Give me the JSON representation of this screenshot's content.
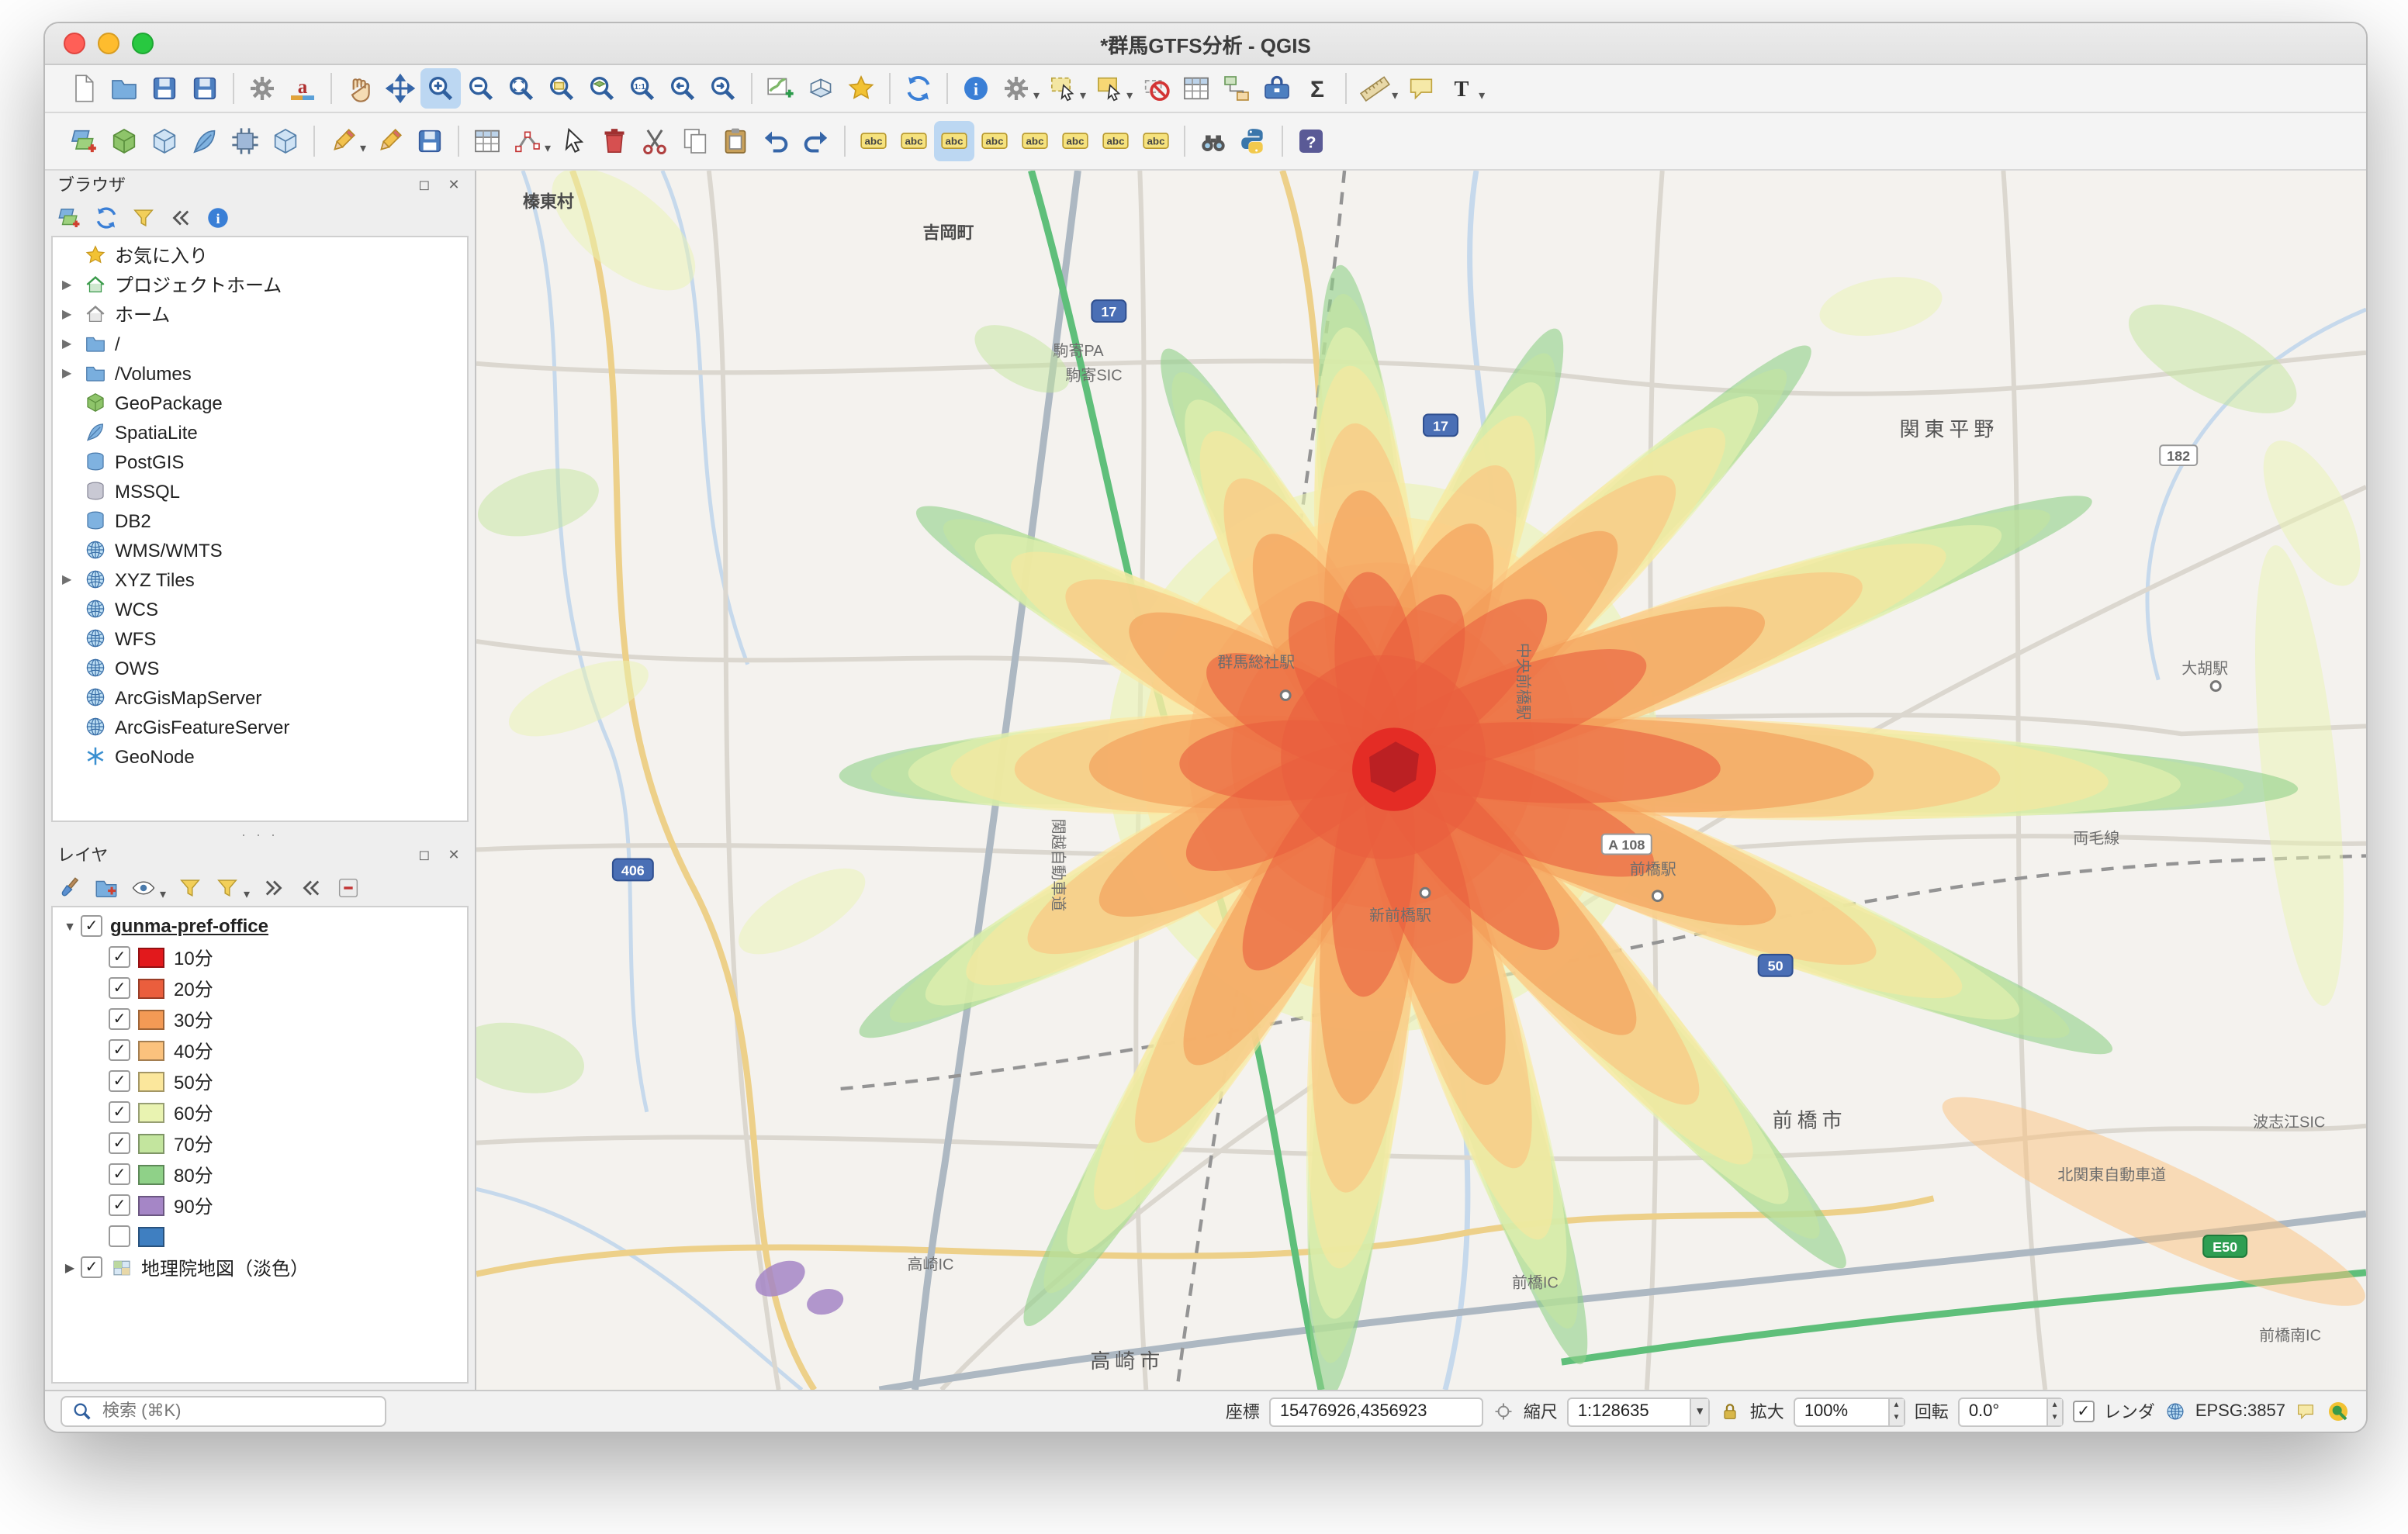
{
  "window": {
    "title": "*群馬GTFS分析 - QGIS"
  },
  "browser": {
    "title": "ブラウザ",
    "items": [
      {
        "label": "お気に入り",
        "icon": "star-icon"
      },
      {
        "label": "プロジェクトホーム",
        "icon": "project-home-icon"
      },
      {
        "label": "ホーム",
        "icon": "home-icon"
      },
      {
        "label": "/",
        "icon": "folder-icon"
      },
      {
        "label": "/Volumes",
        "icon": "folder-icon"
      },
      {
        "label": "GeoPackage",
        "icon": "geopackage-icon"
      },
      {
        "label": "SpatiaLite",
        "icon": "spatialite-icon"
      },
      {
        "label": "PostGIS",
        "icon": "database-icon"
      },
      {
        "label": "MSSQL",
        "icon": "database-icon"
      },
      {
        "label": "DB2",
        "icon": "database-icon"
      },
      {
        "label": "WMS/WMTS",
        "icon": "globe-icon"
      },
      {
        "label": "XYZ Tiles",
        "icon": "globe-icon"
      },
      {
        "label": "WCS",
        "icon": "globe-icon"
      },
      {
        "label": "WFS",
        "icon": "globe-icon"
      },
      {
        "label": "OWS",
        "icon": "globe-icon"
      },
      {
        "label": "ArcGisMapServer",
        "icon": "globe-icon"
      },
      {
        "label": "ArcGisFeatureServer",
        "icon": "globe-icon"
      },
      {
        "label": "GeoNode",
        "icon": "geonode-icon"
      }
    ]
  },
  "layers": {
    "title": "レイヤ",
    "group_label": "gunma-pref-office",
    "legend": [
      {
        "label": "10分",
        "color": "#e2191c"
      },
      {
        "label": "20分",
        "color": "#ea5e3d"
      },
      {
        "label": "30分",
        "color": "#f39a55"
      },
      {
        "label": "40分",
        "color": "#fbc27d"
      },
      {
        "label": "50分",
        "color": "#fbe79c"
      },
      {
        "label": "60分",
        "color": "#e9f3b1"
      },
      {
        "label": "70分",
        "color": "#c3e59e"
      },
      {
        "label": "80分",
        "color": "#8fd188"
      },
      {
        "label": "90分",
        "color": "#a586c6"
      },
      {
        "label": "",
        "color": "#3f7fc1"
      }
    ],
    "basemap_label": "地理院地図（淡色）"
  },
  "statusbar": {
    "search_placeholder": "検索 (⌘K)",
    "coord_label": "座標",
    "coord_value": "15476926,4356923",
    "scale_label": "縮尺",
    "scale_value": "1:128635",
    "magnifier_label": "拡大",
    "magnifier_value": "100%",
    "rotation_label": "回転",
    "rotation_value": "0.0°",
    "render_label": "レンダ",
    "crs": "EPSG:3857"
  },
  "map": {
    "labels": [
      {
        "text": "榛東村"
      },
      {
        "text": "吉岡町"
      },
      {
        "text": "駒寄PA"
      },
      {
        "text": "駒寄SIC"
      },
      {
        "text": "関東平野"
      },
      {
        "text": "群馬総社駅"
      },
      {
        "text": "関越自動車道"
      },
      {
        "text": "中央前橋駅"
      },
      {
        "text": "新前橋駅"
      },
      {
        "text": "前橋駅"
      },
      {
        "text": "両毛線"
      },
      {
        "text": "前橋市"
      },
      {
        "text": "前橋IC"
      },
      {
        "text": "高崎IC"
      },
      {
        "text": "高崎市"
      },
      {
        "text": "北関東自動車道"
      },
      {
        "text": "波志江SIC"
      },
      {
        "text": "前橋南IC"
      },
      {
        "text": "大胡駅"
      }
    ],
    "shields": [
      {
        "text": "17"
      },
      {
        "text": "17"
      },
      {
        "text": "50"
      },
      {
        "text": "406"
      },
      {
        "text": "182"
      },
      {
        "text": "A 108"
      },
      {
        "text": "E50"
      }
    ]
  },
  "icons": {
    "new-project": "page",
    "open-project": "folder",
    "save-project": "disk",
    "save-project-as": "disk",
    "project-properties": "gear",
    "style-manager": "letter-a",
    "pan-map": "hand",
    "pan-to-selection": "move-arrows",
    "zoom-in": "magnifier-plus",
    "zoom-out": "magnifier-minus",
    "zoom-full": "magnifier-extent",
    "zoom-to-selection": "magnifier-selection",
    "zoom-to-layer": "magnifier-layer",
    "zoom-native": "magnifier-1-1",
    "zoom-last": "magnifier-back",
    "zoom-next": "magnifier-forward",
    "new-map-view": "map-plus",
    "new-3d-map-view": "cube-3d",
    "spatial-bookmarks": "star",
    "refresh": "circular-arrows",
    "identify-features": "info-circle",
    "run-feature-action": "gear",
    "select-features": "cursor-selection",
    "select-by-value": "form-selection",
    "deselect-features": "no-selection",
    "open-attribute-table": "table",
    "graphical-modeler": "model-boxes",
    "processing-toolbox": "toolbox",
    "statistical-summary": "sigma",
    "measure": "ruler",
    "map-tips": "speech-bubble",
    "text-annotation": "letter-T",
    "data-source-manager": "layer-stack-plus",
    "new-geopackage-layer": "green-cube",
    "new-virtual-layer": "cube",
    "new-shapefile-layer": "feather",
    "new-memory-layer": "chip",
    "new-spatialite-layer": "cube",
    "current-edits": "pencil",
    "toggle-editing": "pencil",
    "save-layer-edits": "disk",
    "add-record": "table",
    "vertex-tool": "vertex-nodes",
    "multi-edit": "cursor",
    "delete-selected": "trash",
    "cut-features": "scissors",
    "copy-features": "copy-pages",
    "paste-features": "clipboard",
    "undo": "arc-arrow-left",
    "redo": "arc-arrow-right",
    "layer-labeling": "abc-tag",
    "layer-diagram": "abc-tag",
    "pin-labels": "abc-tag",
    "highlight-labels": "abc-tag",
    "move-label": "abc-tag",
    "rotate-label": "abc-tag",
    "change-label": "abc-tag",
    "show-hide-labels": "abc-tag",
    "osm-place-search": "binoculars",
    "python-console": "python-snakes",
    "help": "question-square",
    "browser-add-layers": "layer-stack-plus",
    "browser-refresh": "circular-arrows",
    "browser-filter": "funnel",
    "browser-collapse-all": "chevrons-left",
    "browser-properties": "info-circle",
    "layer-styling": "paintbrush",
    "add-group": "folder-plus",
    "manage-map-themes": "eye",
    "filter-legend": "funnel",
    "filter-legend-expression": "funnel",
    "expand-all": "chevrons-right",
    "collapse-all": "chevrons-left",
    "remove-layer": "minus-box",
    "mouse-position": "crosshair",
    "scale-lock": "padlock",
    "crs-globe": "globe",
    "messages": "speech-bubble",
    "locator": "qgis-ring",
    "search": "magnifier"
  }
}
